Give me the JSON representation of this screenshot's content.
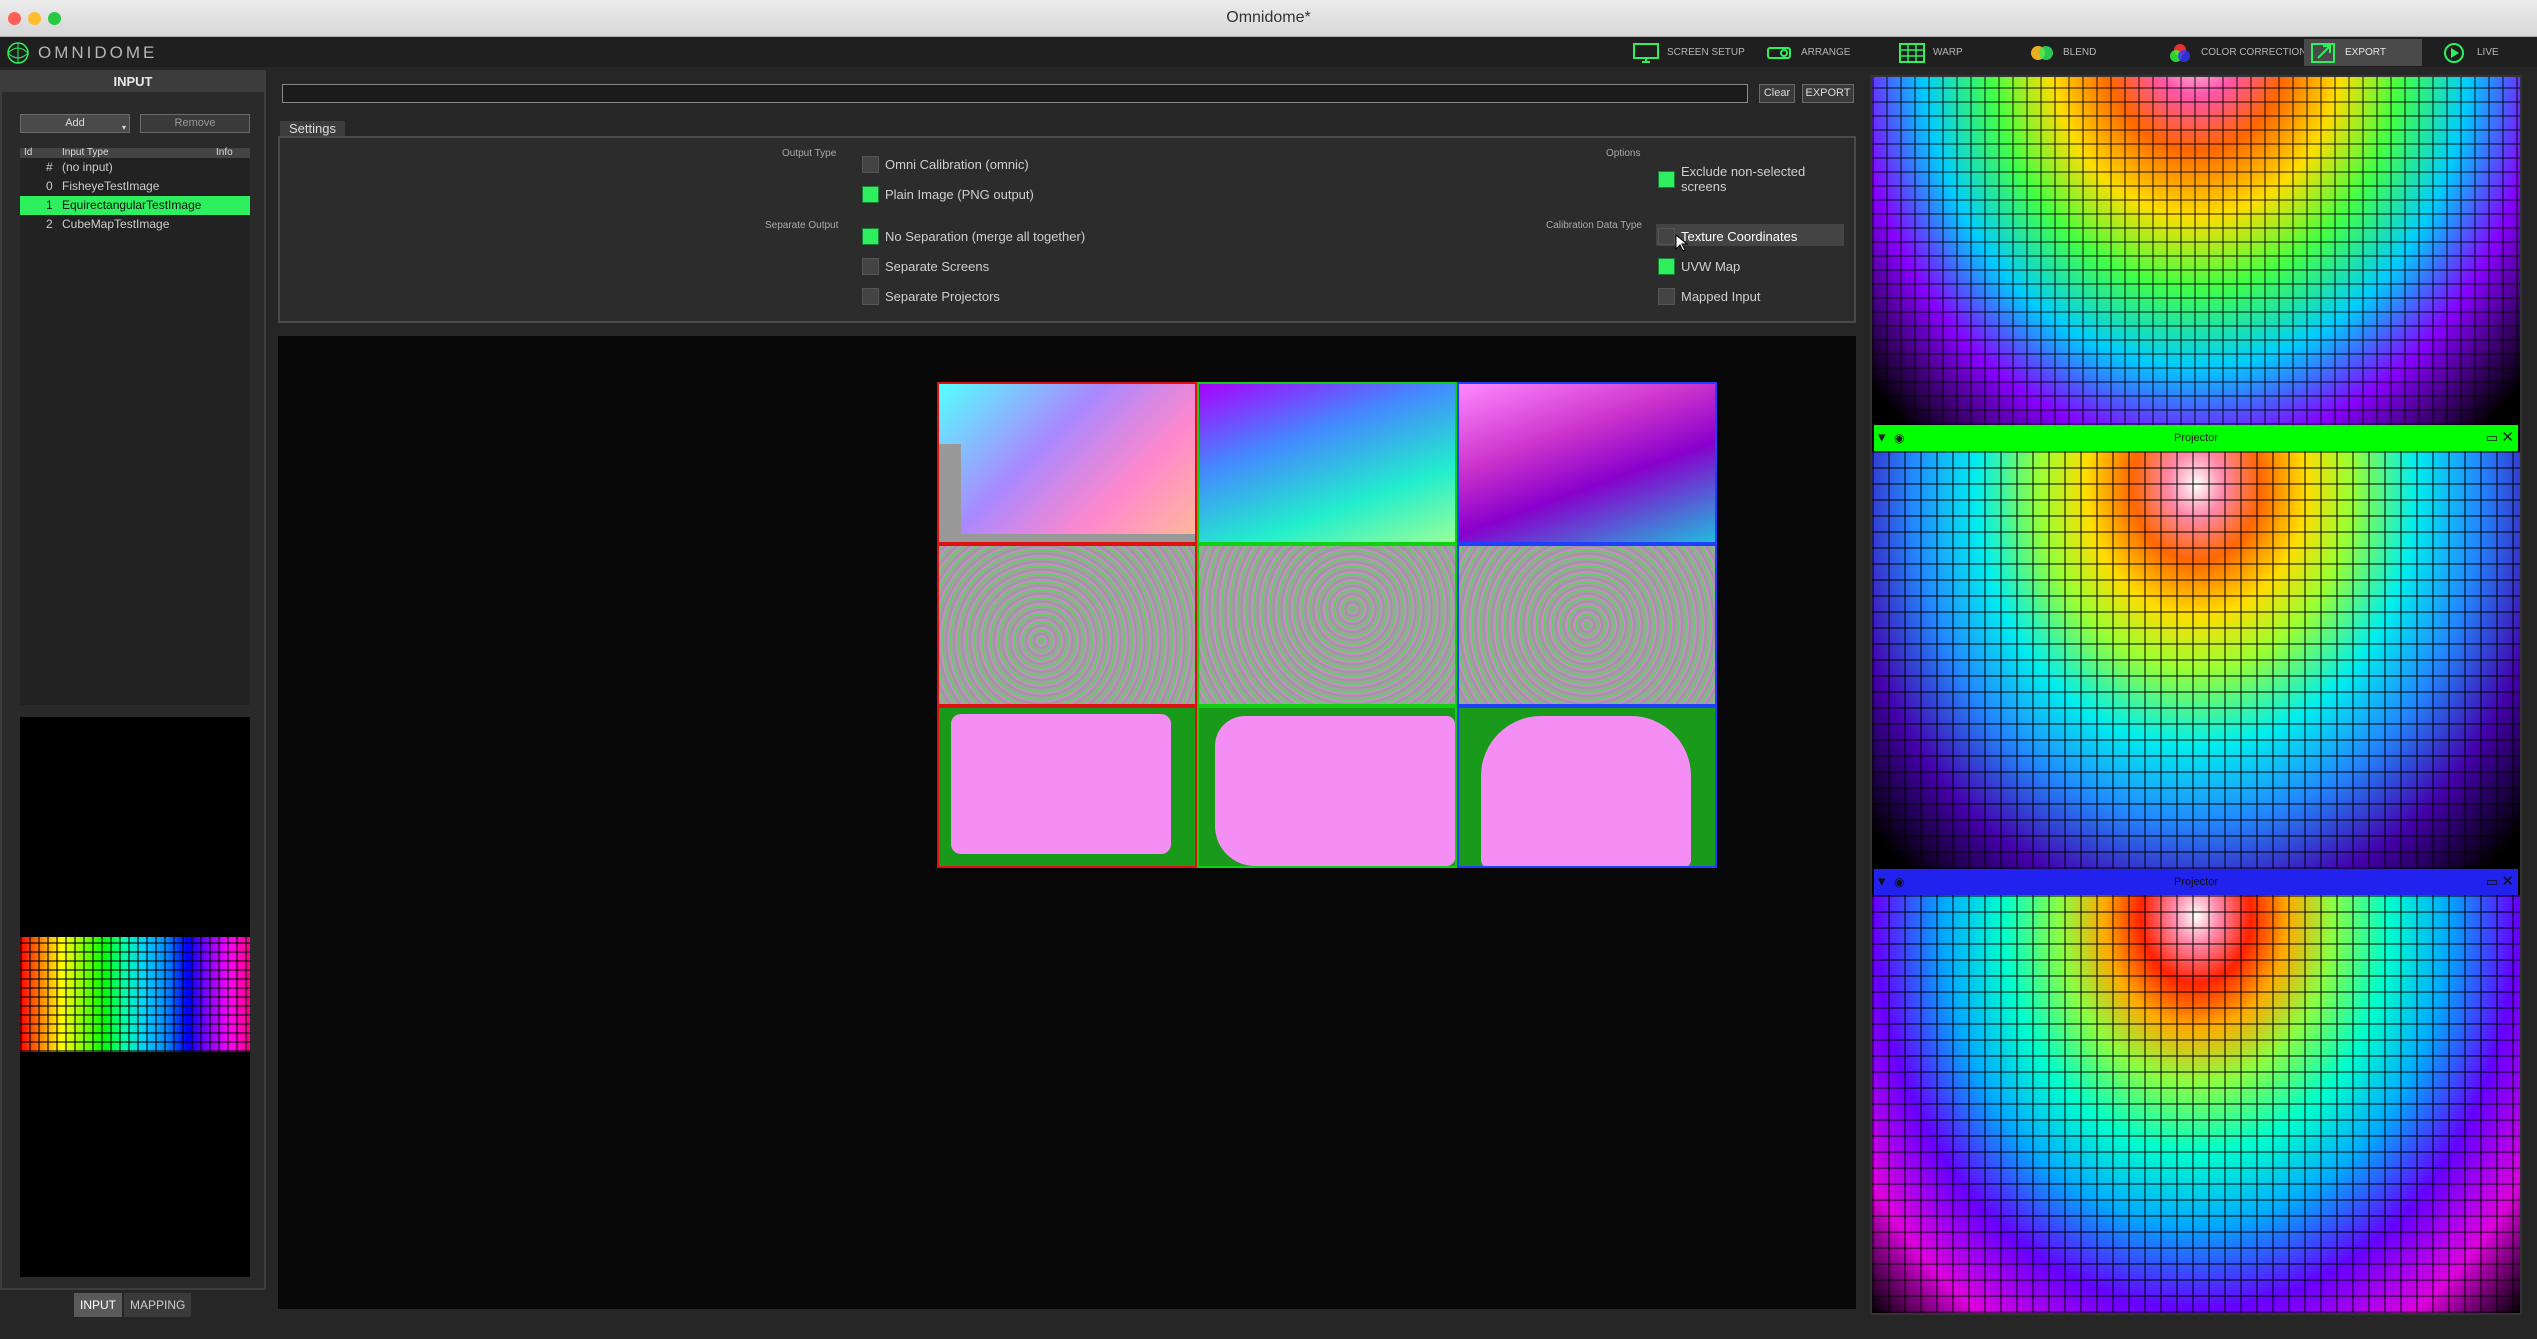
{
  "window": {
    "title": "Omnidome*"
  },
  "app": {
    "logo_text": "OMNIDOME"
  },
  "toolbar": {
    "items": [
      {
        "label": "SCREEN SETUP",
        "icon": "monitor-icon"
      },
      {
        "label": "ARRANGE",
        "icon": "projector-icon"
      },
      {
        "label": "WARP",
        "icon": "warp-grid-icon"
      },
      {
        "label": "BLEND",
        "icon": "blend-icon"
      },
      {
        "label": "COLOR CORRECTION",
        "icon": "color-correction-icon"
      },
      {
        "label": "EXPORT",
        "icon": "export-icon",
        "active": true
      },
      {
        "label": "LIVE",
        "icon": "play-icon"
      }
    ]
  },
  "input_panel": {
    "title": "INPUT",
    "add_label": "Add",
    "remove_label": "Remove",
    "columns": [
      "Id",
      "Input Type",
      "Info"
    ],
    "rows": [
      {
        "id": "#",
        "type": "(no input)"
      },
      {
        "id": "0",
        "type": "FisheyeTestImage"
      },
      {
        "id": "1",
        "type": "EquirectangularTestImage",
        "selected": true
      },
      {
        "id": "2",
        "type": "CubeMapTestImage"
      }
    ],
    "tabs": [
      "INPUT",
      "MAPPING"
    ]
  },
  "export": {
    "path_value": "",
    "clear_label": "Clear",
    "export_label": "EXPORT",
    "settings_tab": "Settings",
    "output_type_label": "Output Type",
    "output_type_options": [
      {
        "label": "Omni Calibration (omnic)",
        "checked": false
      },
      {
        "label": "Plain Image (PNG output)",
        "checked": true
      }
    ],
    "separate_output_label": "Separate Output",
    "separate_output_options": [
      {
        "label": "No Separation (merge all together)",
        "checked": true
      },
      {
        "label": "Separate Screens",
        "checked": false
      },
      {
        "label": "Separate Projectors",
        "checked": false
      }
    ],
    "options_label": "Options",
    "options": [
      {
        "label": "Exclude non-selected screens",
        "checked": true
      }
    ],
    "calibration_label": "Calibration Data Type",
    "calibration_options": [
      {
        "label": "Texture Coordinates",
        "checked": false
      },
      {
        "label": "UVW Map",
        "checked": true
      },
      {
        "label": "Mapped Input",
        "checked": false
      }
    ]
  },
  "projectors": [
    {
      "title": "Projector",
      "color": "#00ff00"
    },
    {
      "title": "Projector",
      "color": "#2222ee"
    }
  ],
  "colors": {
    "accent": "#2ef05f",
    "proj_red": "#e01010",
    "proj_green": "#10d010",
    "proj_blue": "#2040ff"
  }
}
